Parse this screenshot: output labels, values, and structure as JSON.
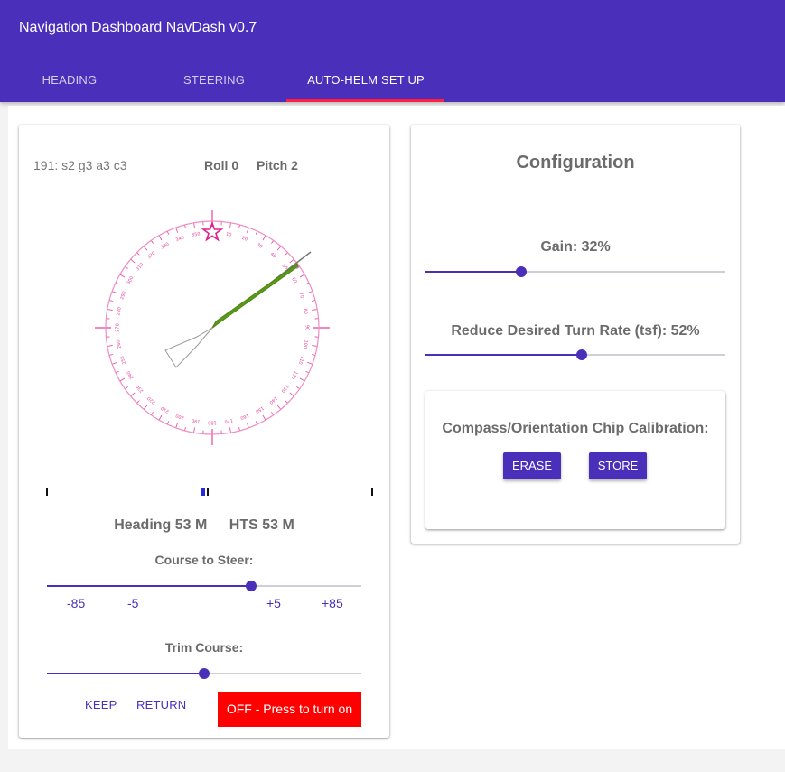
{
  "app": {
    "title": "Navigation Dashboard NavDash v0.7"
  },
  "tabs": [
    {
      "label": "HEADING",
      "active": false
    },
    {
      "label": "STEERING",
      "active": false
    },
    {
      "label": "AUTO-HELM SET UP",
      "active": true
    }
  ],
  "colors": {
    "primary": "#4a2fbb",
    "tab_indicator": "#ff2040",
    "autohelm_off": "#ff0000",
    "compass": "#e8439a",
    "heading_needle": "#5a9a1a"
  },
  "steering_panel": {
    "status": "191: s2 g3 a3 c3",
    "roll": "Roll 0",
    "pitch": "Pitch 2",
    "compass": {
      "heading_deg": 53,
      "star_marker": "star-icon"
    },
    "heading_text": "Heading 53 M",
    "hts_text": "HTS 53 M",
    "course_to_steer_label": "Course to Steer:",
    "course_slider_value": 0.65,
    "step_labels": [
      "-85",
      "-5",
      "+5",
      "+85"
    ],
    "trim_course_label": "Trim Course:",
    "trim_slider_value": 0.5,
    "keep_label": "KEEP",
    "return_label": "RETURN",
    "autohelm_button": "OFF - Press to turn on"
  },
  "configuration": {
    "title": "Configuration",
    "gain_label": "Gain: 32%",
    "gain_value": 0.32,
    "turn_rate_label": "Reduce Desired Turn Rate (tsf): 52%",
    "turn_rate_value": 0.52,
    "calibration": {
      "title": "Compass/Orientation Chip Calibration:",
      "erase_label": "ERASE",
      "store_label": "STORE"
    }
  }
}
